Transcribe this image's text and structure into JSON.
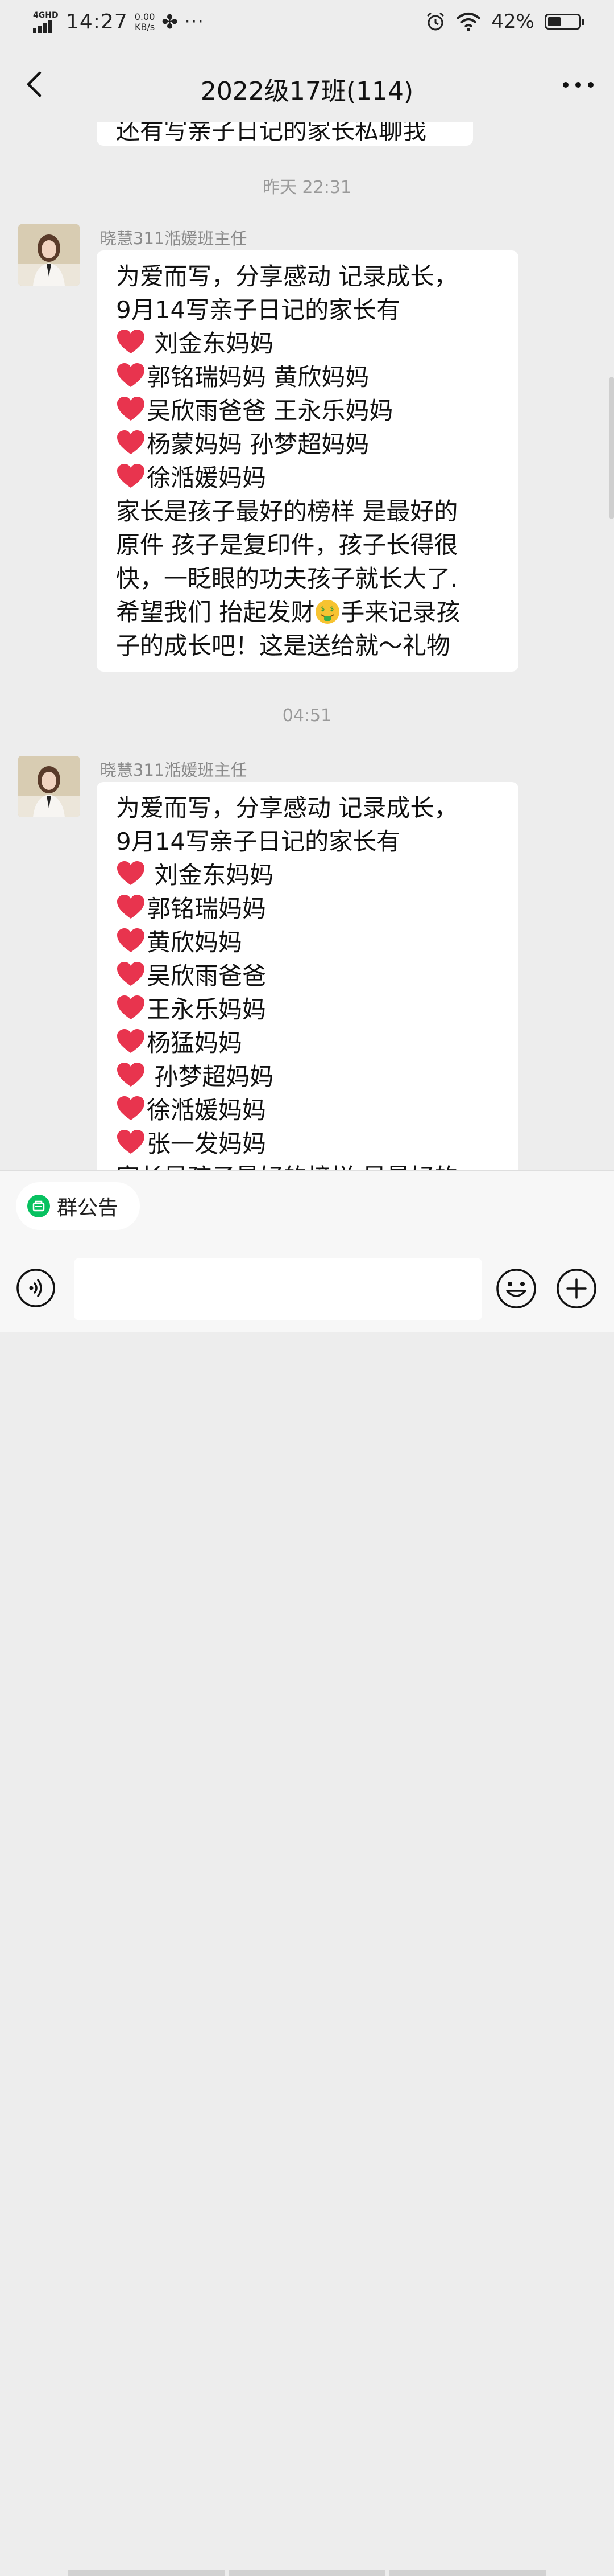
{
  "status_bar": {
    "network": "4GHD",
    "time": "14:27",
    "speed_value": "0.00",
    "speed_unit": "KB/s",
    "overflow": "···",
    "battery": "42%",
    "battery_level": 0.42
  },
  "header": {
    "title": "2022级17班(114)"
  },
  "chat": {
    "prev_fragment": "还有写亲子日记的家长私聊我",
    "messages": [
      {
        "timestamp": "昨天 22:31",
        "sender": "晓慧311湉媛班主任",
        "lines": [
          {
            "heart": false,
            "text": "为爱而写，分享感动 记录成长，"
          },
          {
            "heart": false,
            "text": "9月14写亲子日记的家长有"
          },
          {
            "heart": true,
            "text": " 刘金东妈妈"
          },
          {
            "heart": true,
            "text": "郭铭瑞妈妈 黄欣妈妈"
          },
          {
            "heart": true,
            "text": "吴欣雨爸爸 王永乐妈妈"
          },
          {
            "heart": true,
            "text": "杨蒙妈妈  孙梦超妈妈"
          },
          {
            "heart": true,
            "text": "徐湉媛妈妈"
          },
          {
            "heart": false,
            "text": "家长是孩子最好的榜样 是最好的"
          },
          {
            "heart": false,
            "text": "原件 孩子是复印件，孩子长得很"
          },
          {
            "heart": false,
            "text": "快，一眨眼的功夫孩子就长大了."
          },
          {
            "heart": false,
            "text": "希望我们 抬起发财",
            "emoji_after": "money-mouth-face",
            "text_after": "手来记录孩"
          },
          {
            "heart": false,
            "text": "子的成长吧！这是送给就～礼物"
          }
        ]
      },
      {
        "timestamp": "04:51",
        "sender": "晓慧311湉媛班主任",
        "lines": [
          {
            "heart": false,
            "text": "为爱而写，分享感动 记录成长，"
          },
          {
            "heart": false,
            "text": "9月14写亲子日记的家长有"
          },
          {
            "heart": true,
            "text": " 刘金东妈妈"
          },
          {
            "heart": true,
            "text": "郭铭瑞妈妈"
          },
          {
            "heart": true,
            "text": "黄欣妈妈"
          },
          {
            "heart": true,
            "text": "吴欣雨爸爸"
          },
          {
            "heart": true,
            "text": "王永乐妈妈"
          },
          {
            "heart": true,
            "text": "杨猛妈妈"
          },
          {
            "heart": true,
            "text": "  孙梦超妈妈"
          },
          {
            "heart": true,
            "text": "徐湉媛妈妈"
          },
          {
            "heart": true,
            "text": "张一发妈妈"
          },
          {
            "heart": false,
            "text": "家长是孩子最好的榜样 是最好的"
          }
        ]
      }
    ]
  },
  "announcement": {
    "label": "群公告"
  },
  "input": {
    "placeholder": ""
  },
  "colors": {
    "background": "#ededed",
    "bubble": "#ffffff",
    "heart": "#e8344e",
    "announce_icon": "#07c160"
  }
}
